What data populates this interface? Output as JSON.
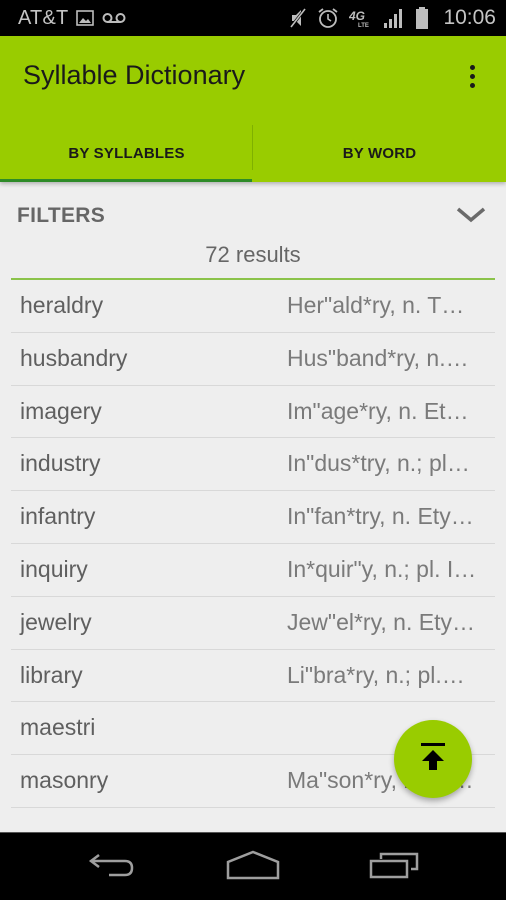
{
  "status_bar": {
    "carrier": "AT&T",
    "time": "10:06",
    "left_icons": [
      "image-icon",
      "voicemail-icon"
    ],
    "right_icons": [
      "mute-icon",
      "alarm-icon",
      "4g-lte-icon",
      "signal-icon",
      "battery-icon"
    ],
    "network_label": "4G"
  },
  "app_bar": {
    "title": "Syllable Dictionary",
    "menu_icon": "more-vert-icon",
    "color": "#99cc00"
  },
  "tabs": [
    {
      "label": "BY SYLLABLES",
      "selected": true
    },
    {
      "label": "BY WORD",
      "selected": false
    }
  ],
  "filters": {
    "label": "FILTERS",
    "icon": "chevron-down-icon",
    "results": "72 results"
  },
  "results": [
    {
      "word": "heraldry",
      "definition": "Her\"ald*ry, n.  T…"
    },
    {
      "word": "husbandry",
      "definition": "Hus\"band*ry, n.…"
    },
    {
      "word": "imagery",
      "definition": "Im\"age*ry, n. Et…"
    },
    {
      "word": "industry",
      "definition": "In\"dus*try, n.; pl…"
    },
    {
      "word": "infantry",
      "definition": "In\"fan*try, n. Ety…"
    },
    {
      "word": "inquiry",
      "definition": "In*quir\"y, n.; pl. I…"
    },
    {
      "word": "jewelry",
      "definition": "Jew\"el*ry, n. Ety…"
    },
    {
      "word": "library",
      "definition": "Li\"bra*ry, n.; pl.…"
    },
    {
      "word": "maestri",
      "definition": ""
    },
    {
      "word": "masonry",
      "definition": "Ma\"son*ry, n. Et…"
    }
  ],
  "fab": {
    "icon": "scroll-to-top-icon"
  },
  "nav_bar": {
    "buttons": [
      "back-icon",
      "home-icon",
      "recent-apps-icon"
    ]
  }
}
